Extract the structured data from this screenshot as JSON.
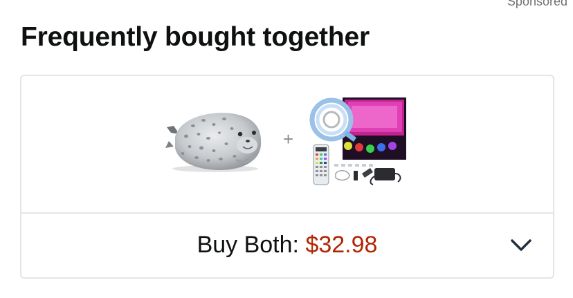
{
  "sponsored_label": "Sponsored",
  "section_title": "Frequently bought together",
  "products": [
    {
      "icon": "seal-plush-image"
    },
    {
      "icon": "led-strip-lights-image"
    }
  ],
  "plus_symbol": "+",
  "buy_both": {
    "label": "Buy Both:",
    "price": "$32.98",
    "expand_icon": "chevron-down-icon"
  },
  "colors": {
    "price": "#b12704",
    "border": "#e3e6e6",
    "text": "#0f1111"
  }
}
